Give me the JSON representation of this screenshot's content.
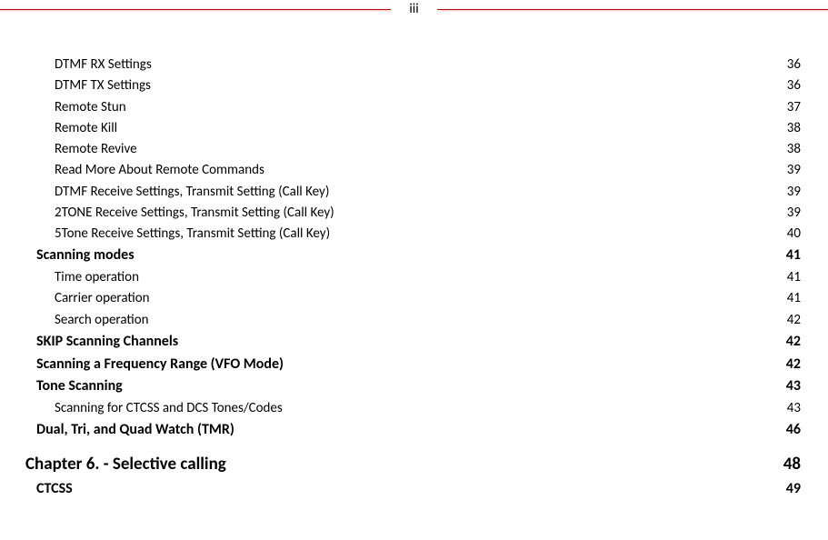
{
  "page_label": "iii",
  "toc": [
    {
      "level": 3,
      "title": "DTMF RX Settings",
      "page": "36"
    },
    {
      "level": 3,
      "title": "DTMF TX Settings",
      "page": "36"
    },
    {
      "level": 3,
      "title": "Remote Stun",
      "page": "37"
    },
    {
      "level": 3,
      "title": "Remote Kill",
      "page": "38"
    },
    {
      "level": 3,
      "title": "Remote Revive",
      "page": "38"
    },
    {
      "level": 3,
      "title": "Read More About Remote Commands",
      "page": "39"
    },
    {
      "level": 3,
      "title": "DTMF Receive Settings, Transmit Setting (Call Key)",
      "page": "39"
    },
    {
      "level": 3,
      "title": "2TONE Receive Settings, Transmit Setting (Call Key)",
      "page": "39"
    },
    {
      "level": 3,
      "title": "5Tone Receive Settings, Transmit Setting (Call Key)",
      "page": "40"
    },
    {
      "level": 2,
      "title": "Scanning  modes",
      "page": "41"
    },
    {
      "level": 3,
      "title": "Time  operation",
      "page": "41"
    },
    {
      "level": 3,
      "title": "Carrier  operation",
      "page": "41"
    },
    {
      "level": 3,
      "title": "Search  operation",
      "page": "42"
    },
    {
      "level": 2,
      "title": "SKIP Scanning Channels",
      "page": "42"
    },
    {
      "level": 2,
      "title": "Scanning a Frequency Range (VFO Mode)",
      "page": "42"
    },
    {
      "level": 2,
      "title": "Tone  Scanning",
      "page": "43"
    },
    {
      "level": 3,
      "title": "Scanning for CTCSS and DCS Tones/Codes",
      "page": "43"
    },
    {
      "level": 2,
      "title": "Dual, Tri, and Quad  Watch (TMR)",
      "page": "46"
    },
    {
      "level": 1,
      "title": "Chapter 6. -  Selective calling",
      "page": "48",
      "gap_before": true
    },
    {
      "level": 2,
      "title": "CTCSS",
      "page": "49"
    }
  ]
}
